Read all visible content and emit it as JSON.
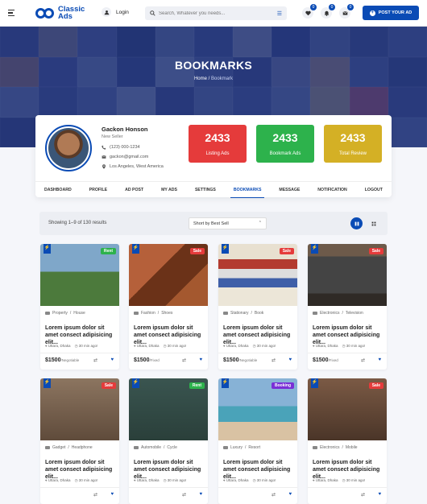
{
  "header": {
    "logo_line1": "Classic",
    "logo_line2": "Ads",
    "login_label": "Login",
    "search_placeholder": "Search, Whatever you needs...",
    "wishlist_count": "0",
    "notify_count": "0",
    "message_count": "0",
    "post_button": "POST YOUR AD"
  },
  "hero": {
    "title": "BOOKMARKS",
    "crumb_home": "Home",
    "crumb_sep": "/",
    "crumb_current": "Bookmark"
  },
  "profile": {
    "name": "Gackon Honson",
    "role": "New Seller",
    "phone": "(123) 000-1234",
    "email": "gackon@gmail.com",
    "location": "Los Angeles, West America",
    "stats": [
      {
        "value": "2433",
        "label": "Listing Ads",
        "color": "#e53b3b"
      },
      {
        "value": "2433",
        "label": "Bookmark Ads",
        "color": "#2db24c"
      },
      {
        "value": "2433",
        "label": "Total Review",
        "color": "#d4b025"
      }
    ],
    "tabs": [
      "DASHBOARD",
      "PROFILE",
      "AD POST",
      "MY ADS",
      "SETTINGS",
      "BOOKMARKS",
      "MESSAGE",
      "NOTIFICATION",
      "LOGOUT"
    ],
    "active_tab": "BOOKMARKS"
  },
  "results": {
    "count_text": "Showing 1–9 of 130 results",
    "sort_value": "Short by Best Sell"
  },
  "cards": [
    {
      "badge": "Rent",
      "badge_color": "#2db24c",
      "category": "Property",
      "subcategory": "House",
      "title": "Lorem ipsum dolor sit amet consect adipisicing elit...",
      "location": "Uttara, Dhaka",
      "time": "30 min ago!",
      "price": "$1500",
      "price_type": "/Negotiable",
      "img": "house"
    },
    {
      "badge": "Sale",
      "badge_color": "#e53b3b",
      "category": "Fashion",
      "subcategory": "Shoes",
      "title": "Lorem ipsum dolor sit amet consect adipisicing elit...",
      "location": "Uttara, Dhaka",
      "time": "30 min ago!",
      "price": "$1500",
      "price_type": "/Fixed",
      "img": "shoes"
    },
    {
      "badge": "Sale",
      "badge_color": "#e53b3b",
      "category": "Stationary",
      "subcategory": "Book",
      "title": "Lorem ipsum dolor sit amet consect adipisicing elit...",
      "location": "Uttara, Dhaka",
      "time": "30 min ago!",
      "price": "$1500",
      "price_type": "/Negotiable",
      "img": "books"
    },
    {
      "badge": "Sale",
      "badge_color": "#e53b3b",
      "category": "Electronics",
      "subcategory": "Television",
      "title": "Lorem ipsum dolor sit amet consect adipisicing elit...",
      "location": "Uttara, Dhaka",
      "time": "30 min ago!",
      "price": "$1500",
      "price_type": "/Fixed",
      "img": "tv"
    },
    {
      "badge": "Sale",
      "badge_color": "#e53b3b",
      "category": "Gadget",
      "subcategory": "Headphone",
      "title": "Lorem ipsum dolor sit amet consect adipisicing elit...",
      "location": "Uttara, Dhaka",
      "time": "30 min ago!",
      "price": "",
      "price_type": "",
      "img": "headphone"
    },
    {
      "badge": "Rent",
      "badge_color": "#2db24c",
      "category": "Automobile",
      "subcategory": "Cycle",
      "title": "Lorem ipsum dolor sit amet consect adipisicing elit...",
      "location": "Uttara, Dhaka",
      "time": "30 min ago!",
      "price": "",
      "price_type": "",
      "img": "cycle"
    },
    {
      "badge": "Booking",
      "badge_color": "#7a2fd6",
      "category": "Luxury",
      "subcategory": "Resort",
      "title": "Lorem ipsum dolor sit amet consect adipisicing elit...",
      "location": "Uttara, Dhaka",
      "time": "30 min ago!",
      "price": "",
      "price_type": "",
      "img": "resort"
    },
    {
      "badge": "Sale",
      "badge_color": "#e53b3b",
      "category": "Electronics",
      "subcategory": "Mobile",
      "title": "Lorem ipsum dolor sit amet consect adipisicing elit...",
      "location": "Uttara, Dhaka",
      "time": "30 min ago!",
      "price": "",
      "price_type": "",
      "img": "mobile"
    }
  ],
  "icons": {
    "brand": "#0a4bb5"
  }
}
